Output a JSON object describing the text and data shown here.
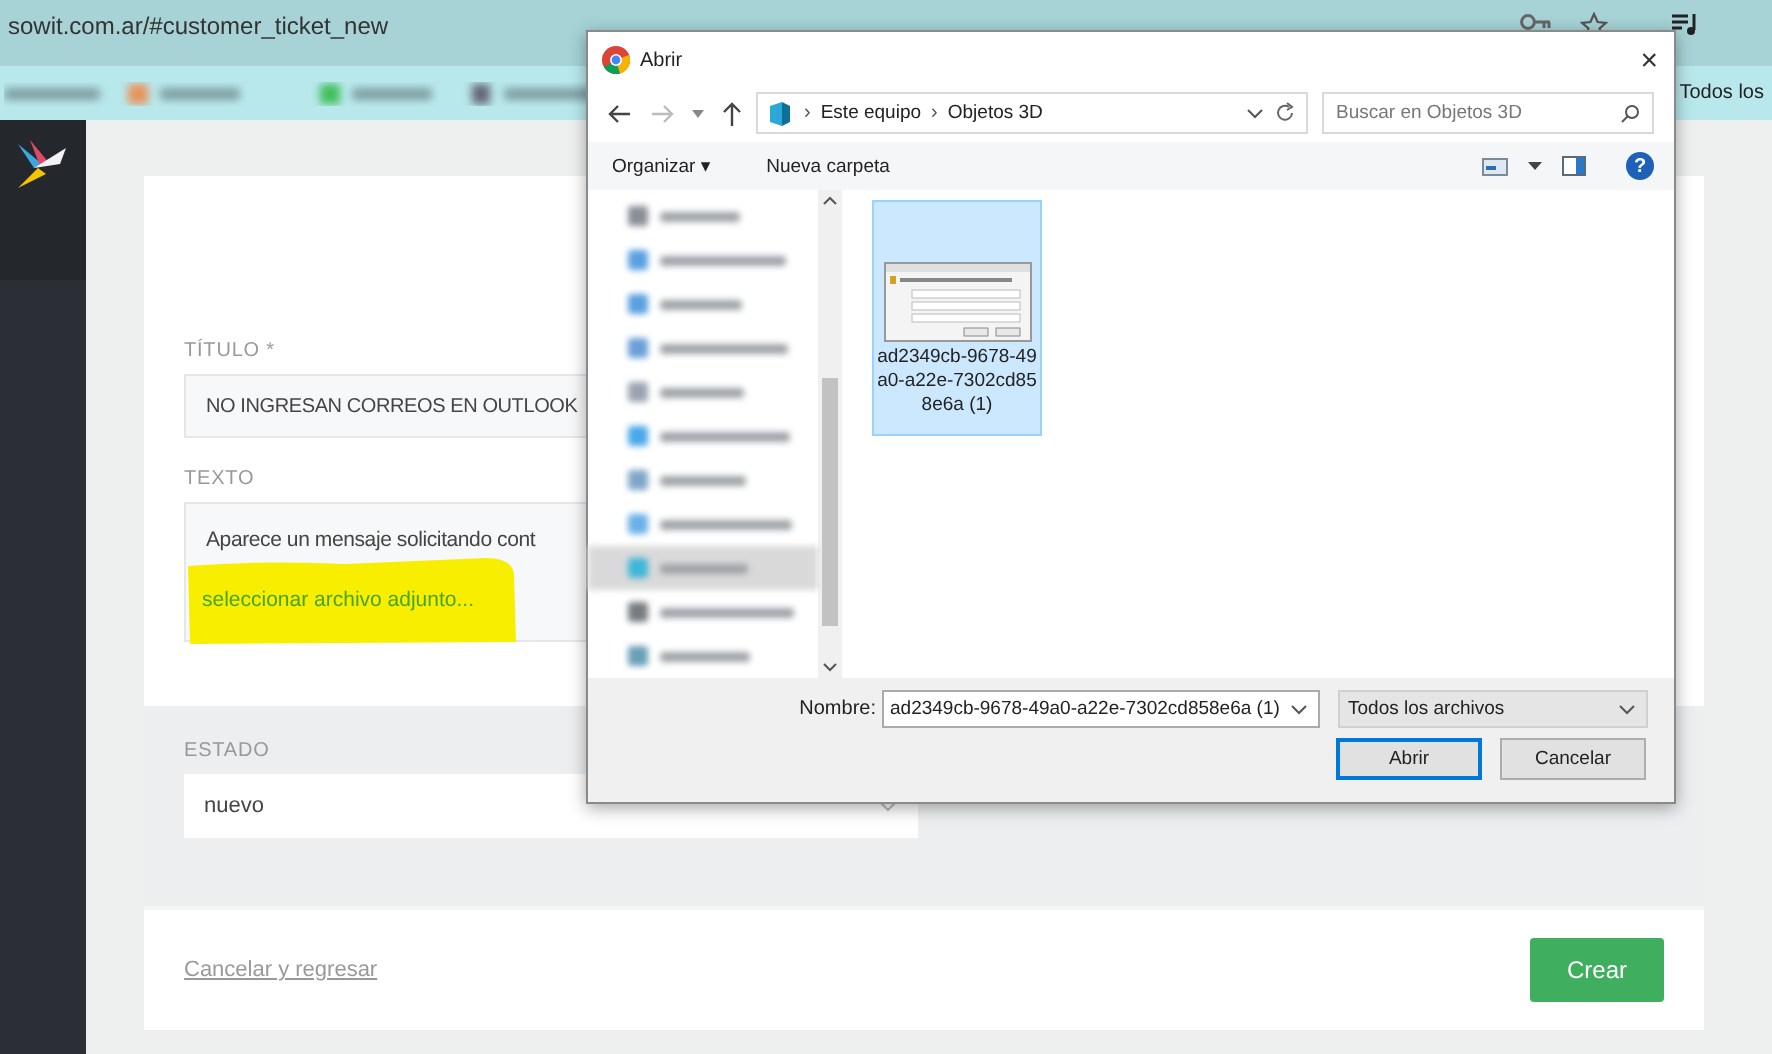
{
  "browser": {
    "url": "sowit.com.ar/#customer_ticket_new",
    "bookmarks_overflow": "Todos los"
  },
  "form": {
    "title_field": {
      "label": "TÍTULO *",
      "value": "NO INGRESAN CORREOS EN OUTLOOK"
    },
    "text_field": {
      "label": "TEXTO",
      "value": "Aparece un mensaje solicitando cont",
      "attach_link": "seleccionar archivo adjunto...",
      "highlighted": true
    },
    "status_field": {
      "label": "ESTADO",
      "value": "nuevo"
    },
    "cancel_link": "Cancelar y regresar",
    "create_button": "Crear"
  },
  "dialog": {
    "title": "Abrir",
    "close": "×",
    "path": [
      {
        "sep": "›",
        "label": "Este equipo"
      },
      {
        "sep": "›",
        "label": "Objetos 3D"
      }
    ],
    "search_placeholder": "Buscar en Objetos 3D",
    "toolbar": {
      "organize": "Organizar",
      "organize_caret": "▾",
      "new_folder": "Nueva carpeta",
      "help": "?"
    },
    "nav_items": [
      {
        "selected": false
      },
      {
        "selected": false
      },
      {
        "selected": false
      },
      {
        "selected": false
      },
      {
        "selected": false
      },
      {
        "selected": false
      },
      {
        "selected": false
      },
      {
        "selected": false
      },
      {
        "selected": true
      },
      {
        "selected": false
      },
      {
        "selected": false
      }
    ],
    "files": [
      {
        "name": "ad2349cb-9678-49a0-a22e-7302cd858e6a (1)",
        "selected": true
      }
    ],
    "filename_label": "Nombre:",
    "filename_value": "ad2349cb-9678-49a0-a22e-7302cd858e6a (1)",
    "filetype": "Todos los archivos",
    "buttons": [
      {
        "label": "Abrir",
        "default": true
      },
      {
        "label": "Cancelar",
        "default": false
      }
    ]
  }
}
